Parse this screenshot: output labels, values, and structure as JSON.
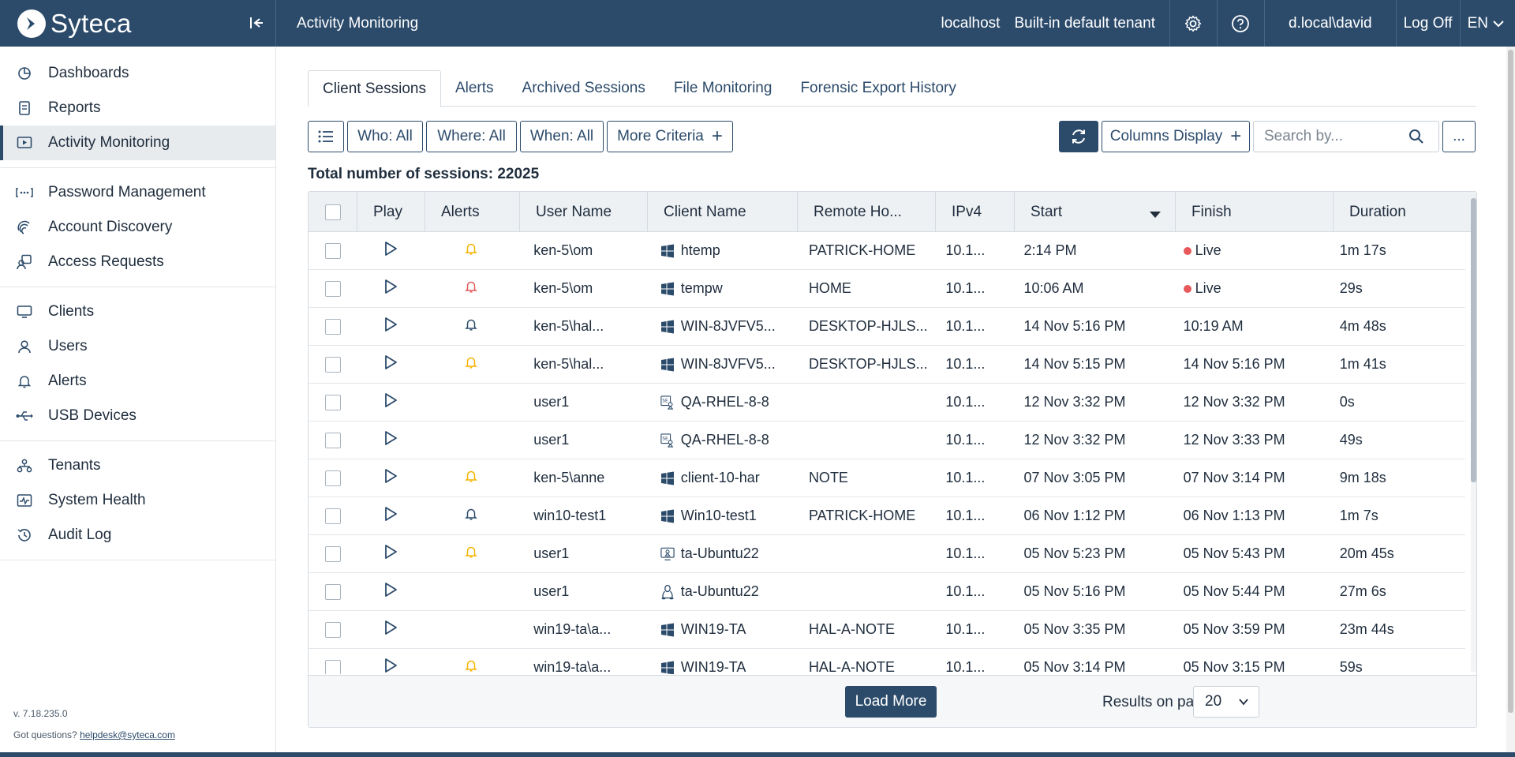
{
  "app": {
    "logo_text": "Syteca",
    "page_heading": "Activity Monitoring",
    "server": "localhost",
    "tenant": "Built-in default tenant",
    "user": "d.local\\david",
    "logoff": "Log Off",
    "language": "EN"
  },
  "sidebar": {
    "groups": [
      [
        {
          "label": "Dashboards",
          "icon": "pie-chart-icon"
        },
        {
          "label": "Reports",
          "icon": "document-icon"
        },
        {
          "label": "Activity Monitoring",
          "icon": "play-monitor-icon",
          "active": true
        }
      ],
      [
        {
          "label": "Password Management",
          "icon": "password-dots-icon"
        },
        {
          "label": "Account Discovery",
          "icon": "fingerprint-icon"
        },
        {
          "label": "Access Requests",
          "icon": "access-request-icon"
        }
      ],
      [
        {
          "label": "Clients",
          "icon": "monitor-icon"
        },
        {
          "label": "Users",
          "icon": "user-icon"
        },
        {
          "label": "Alerts",
          "icon": "bell-icon"
        },
        {
          "label": "USB Devices",
          "icon": "usb-icon"
        }
      ],
      [
        {
          "label": "Tenants",
          "icon": "tenants-icon"
        },
        {
          "label": "System Health",
          "icon": "health-icon"
        },
        {
          "label": "Audit Log",
          "icon": "history-icon"
        }
      ]
    ],
    "version": "v. 7.18.235.0",
    "help_prefix": "Got questions? ",
    "help_email": "helpdesk@syteca.com"
  },
  "tabs": [
    {
      "label": "Client Sessions",
      "active": true
    },
    {
      "label": "Alerts"
    },
    {
      "label": "Archived Sessions"
    },
    {
      "label": "File Monitoring"
    },
    {
      "label": "Forensic Export History"
    }
  ],
  "toolbar": {
    "who": "Who: All",
    "where": "Where: All",
    "when": "When: All",
    "more": "More Criteria",
    "columns": "Columns Display",
    "search_placeholder": "Search by...",
    "more_actions": "..."
  },
  "total_label": "Total number of sessions: 22025",
  "columns": [
    "Play",
    "Alerts",
    "User Name",
    "Client Name",
    "Remote Ho...",
    "IPv4",
    "Start",
    "Finish",
    "Duration"
  ],
  "colors": {
    "alert_yellow": "#f5b400",
    "alert_red": "#e6585a",
    "alert_blue": "#2c4b6b",
    "live": "#e6585a"
  },
  "rows": [
    {
      "alert": "yellow",
      "user": "ken-5\\om",
      "os": "windows",
      "client": "htemp",
      "remote": "PATRICK-HOME",
      "ipv4": "10.1...",
      "start": "2:14 PM",
      "finish": "Live",
      "live": true,
      "duration": "1m 17s"
    },
    {
      "alert": "red",
      "user": "ken-5\\om",
      "os": "windows",
      "client": "tempw",
      "remote": "HOME",
      "ipv4": "10.1...",
      "start": "10:06 AM",
      "finish": "Live",
      "live": true,
      "duration": "29s"
    },
    {
      "alert": "blue",
      "user": "ken-5\\hal...",
      "os": "windows",
      "client": "WIN-8JVFV5...",
      "remote": "DESKTOP-HJLS...",
      "ipv4": "10.1...",
      "start": "14 Nov 5:16 PM",
      "finish": "10:19 AM",
      "duration": "4m 48s"
    },
    {
      "alert": "yellow",
      "user": "ken-5\\hal...",
      "os": "windows",
      "client": "WIN-8JVFV5...",
      "remote": "DESKTOP-HJLS...",
      "ipv4": "10.1...",
      "start": "14 Nov 5:15 PM",
      "finish": "14 Nov 5:16 PM",
      "duration": "1m 41s"
    },
    {
      "alert": "",
      "user": "user1",
      "os": "selinux",
      "client": "QA-RHEL-8-8",
      "remote": "",
      "ipv4": "10.1...",
      "start": "12 Nov 3:32 PM",
      "finish": "12 Nov 3:32 PM",
      "duration": "0s"
    },
    {
      "alert": "",
      "user": "user1",
      "os": "selinux",
      "client": "QA-RHEL-8-8",
      "remote": "",
      "ipv4": "10.1...",
      "start": "12 Nov 3:32 PM",
      "finish": "12 Nov 3:33 PM",
      "duration": "49s"
    },
    {
      "alert": "yellow",
      "user": "ken-5\\anne",
      "os": "windows",
      "client": "client-10-har",
      "remote": "NOTE",
      "ipv4": "10.1...",
      "start": "07 Nov 3:05 PM",
      "finish": "07 Nov 3:14 PM",
      "duration": "9m 18s"
    },
    {
      "alert": "blue",
      "user": "win10-test1",
      "os": "windows",
      "client": "Win10-test1",
      "remote": "PATRICK-HOME",
      "ipv4": "10.1...",
      "start": "06 Nov 1:12 PM",
      "finish": "06 Nov 1:13 PM",
      "duration": "1m 7s"
    },
    {
      "alert": "yellow",
      "user": "user1",
      "os": "linux-monitor",
      "client": "ta-Ubuntu22",
      "remote": "",
      "ipv4": "10.1...",
      "start": "05 Nov 5:23 PM",
      "finish": "05 Nov 5:43 PM",
      "duration": "20m 45s"
    },
    {
      "alert": "",
      "user": "user1",
      "os": "linux",
      "client": "ta-Ubuntu22",
      "remote": "",
      "ipv4": "10.1...",
      "start": "05 Nov 5:16 PM",
      "finish": "05 Nov 5:44 PM",
      "duration": "27m 6s"
    },
    {
      "alert": "",
      "user": "win19-ta\\a...",
      "os": "windows",
      "client": "WIN19-TA",
      "remote": "HAL-A-NOTE",
      "ipv4": "10.1...",
      "start": "05 Nov 3:35 PM",
      "finish": "05 Nov 3:59 PM",
      "duration": "23m 44s"
    },
    {
      "alert": "yellow",
      "user": "win19-ta\\a...",
      "os": "windows",
      "client": "WIN19-TA",
      "remote": "HAL-A-NOTE",
      "ipv4": "10.1...",
      "start": "05 Nov 3:14 PM",
      "finish": "05 Nov 3:15 PM",
      "duration": "59s"
    }
  ],
  "footer": {
    "load_more": "Load More",
    "results_label": "Results on page",
    "results_value": "20"
  }
}
